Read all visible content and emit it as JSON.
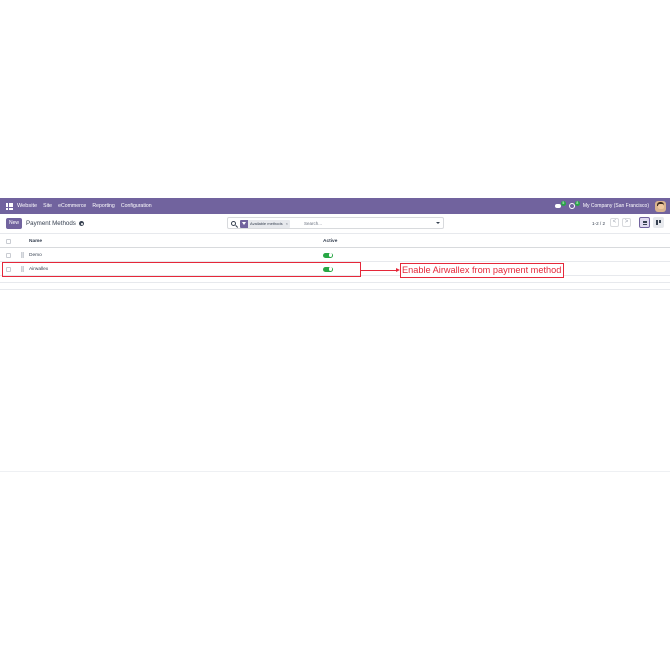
{
  "topbar": {
    "brand": "Website",
    "menu": [
      "Site",
      "eCommerce",
      "Reporting",
      "Configuration"
    ],
    "chat_badge": "5",
    "activity_badge": "8",
    "company": "My Company (San Francisco)"
  },
  "control_panel": {
    "new_label": "New",
    "title": "Payment Methods",
    "facet_label": "Available methods",
    "facet_close": "×",
    "search_placeholder": "Search...",
    "pager": "1-2 / 2",
    "prev": "<",
    "next": ">"
  },
  "table": {
    "columns": [
      "Name",
      "Active"
    ],
    "rows": [
      {
        "name": "Demo",
        "active": true
      },
      {
        "name": "Airwallex",
        "active": true
      }
    ]
  },
  "annotation": {
    "text": "Enable  Airwallex from payment method",
    "color": "#e5283a"
  },
  "colors": {
    "brand": "#71639e",
    "toggle_on": "#28a745"
  },
  "icons": [
    "apps-icon",
    "chat-icon",
    "clock-icon",
    "gear-icon",
    "search-icon",
    "filter-icon",
    "caret-down-icon",
    "list-view-icon",
    "kanban-view-icon",
    "drag-handle-icon"
  ]
}
